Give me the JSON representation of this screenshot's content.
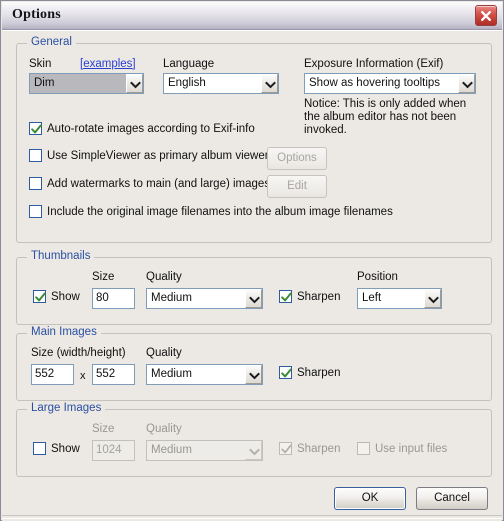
{
  "window": {
    "title": "Options",
    "close_icon": "close-icon"
  },
  "general": {
    "legend": "General",
    "skin": {
      "label": "Skin",
      "examples_link": "[examples]",
      "value": "Dim"
    },
    "language": {
      "label": "Language",
      "value": "English"
    },
    "exif": {
      "label": "Exposure Information (Exif)",
      "value": "Show as hovering tooltips",
      "notice": "Notice: This is only added when the album editor has not been invoked."
    },
    "checkboxes": [
      {
        "label": "Auto-rotate images according to Exif-info",
        "checked": true
      },
      {
        "label": "Use SimpleViewer as primary album viewer",
        "checked": false
      },
      {
        "label": "Add watermarks to main (and large) images",
        "checked": false
      },
      {
        "label": "Include the original image filenames into the album image filenames",
        "checked": false
      }
    ],
    "buttons": {
      "options": "Options",
      "edit": "Edit"
    }
  },
  "thumbnails": {
    "legend": "Thumbnails",
    "show": {
      "label": "Show",
      "checked": true
    },
    "size": {
      "label": "Size",
      "value": "80"
    },
    "quality": {
      "label": "Quality",
      "value": "Medium"
    },
    "sharpen": {
      "label": "Sharpen",
      "checked": true
    },
    "position": {
      "label": "Position",
      "value": "Left"
    }
  },
  "main_images": {
    "legend": "Main Images",
    "size": {
      "label": "Size (width/height)",
      "width": "552",
      "height": "552",
      "separator": "x"
    },
    "quality": {
      "label": "Quality",
      "value": "Medium"
    },
    "sharpen": {
      "label": "Sharpen",
      "checked": true
    }
  },
  "large_images": {
    "legend": "Large Images",
    "show": {
      "label": "Show",
      "checked": false
    },
    "size": {
      "label": "Size",
      "value": "1024"
    },
    "quality": {
      "label": "Quality",
      "value": "Medium"
    },
    "sharpen": {
      "label": "Sharpen",
      "checked": true
    },
    "use_input_files": {
      "label": "Use input files",
      "checked": false
    }
  },
  "footer": {
    "ok": "OK",
    "cancel": "Cancel"
  },
  "colors": {
    "legend_blue": "#2a4fa2",
    "link_blue": "#2a3fd0",
    "check_green": "#3c8a34",
    "dialog_bg": "#ece9e4",
    "field_border": "#7f9db9",
    "close_red": "#bf3b34"
  }
}
